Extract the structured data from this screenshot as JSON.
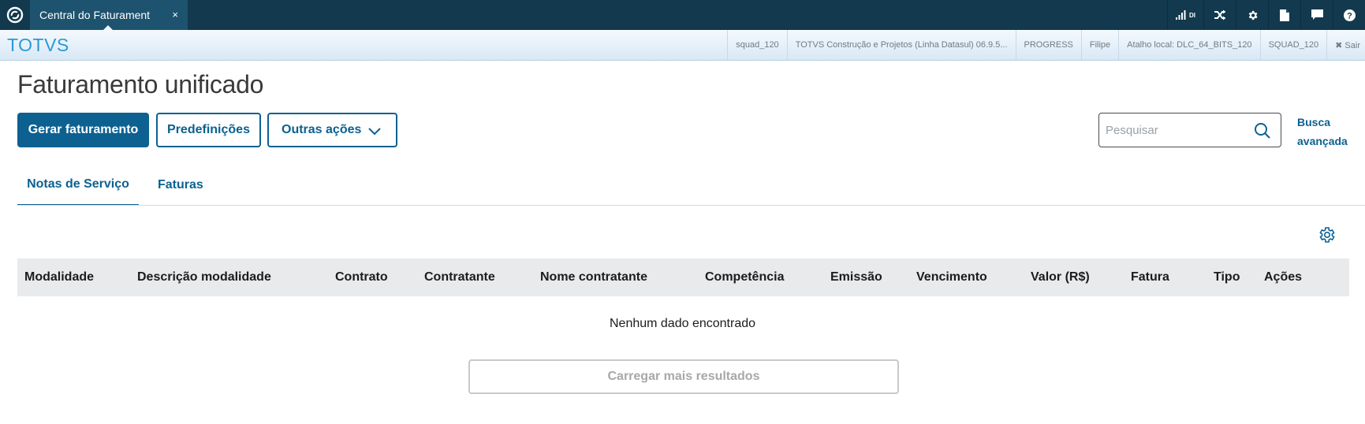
{
  "app_tab": {
    "title": "Central do Faturament",
    "close": "×"
  },
  "top_icons": {
    "signal_label": "DI"
  },
  "infobar": {
    "brand": "TOTVS",
    "items": [
      "squad_120",
      "TOTVS Construção e Projetos (Linha Datasul) 06.9.5...",
      "PROGRESS",
      "Filipe",
      "Atalho local: DLC_64_BITS_120",
      "SQUAD_120"
    ],
    "logout": "✖ Sair"
  },
  "page": {
    "title": "Faturamento unificado"
  },
  "actions": {
    "primary": "Gerar faturamento",
    "secondary": "Predefinições",
    "more": "Outras ações"
  },
  "search": {
    "placeholder": "Pesquisar",
    "advanced_line1": "Busca",
    "advanced_line2": "avançada"
  },
  "tabs": [
    {
      "label": "Notas de Serviço",
      "active": true
    },
    {
      "label": "Faturas",
      "active": false
    }
  ],
  "table": {
    "columns": [
      "Modalidade",
      "Descrição modalidade",
      "Contrato",
      "Contratante",
      "Nome contratante",
      "Competência",
      "Emissão",
      "Vencimento",
      "Valor (R$)",
      "Fatura",
      "Tipo",
      "Ações"
    ],
    "empty_message": "Nenhum dado encontrado",
    "load_more": "Carregar mais resultados"
  },
  "colors": {
    "primary": "#0c6191",
    "topbar": "#12394d",
    "brand": "#2b9ad6"
  }
}
